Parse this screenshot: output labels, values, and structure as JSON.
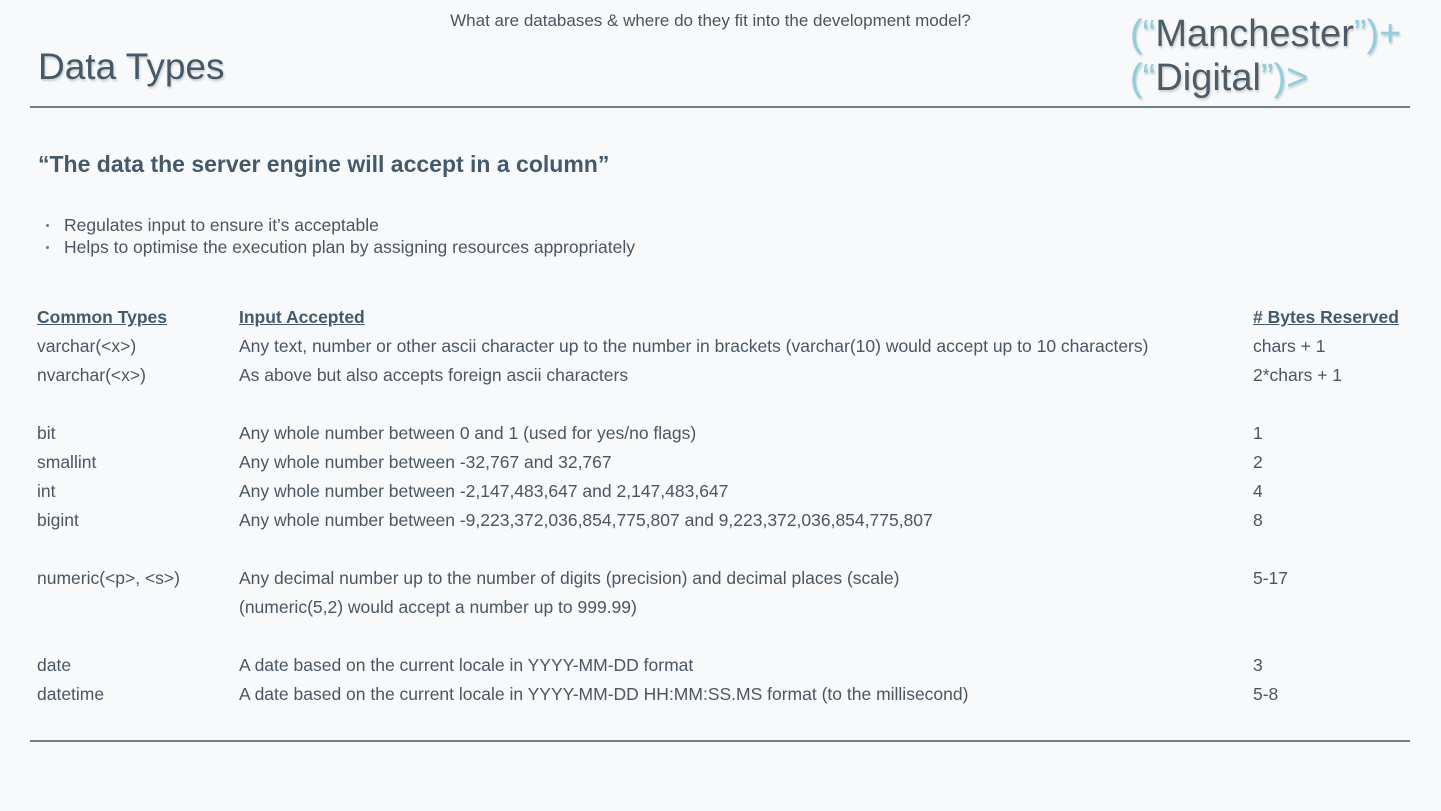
{
  "header": {
    "question": "What are databases & where do they fit into the development model?",
    "title": "Data Types",
    "logo": {
      "line1_open": "(“",
      "line1_word": "Manchester",
      "line1_close": "”)+",
      "line2_open": "(“",
      "line2_word": "Digital",
      "line2_close": "”)>"
    }
  },
  "quote": "“The data the server engine will accept in a column”",
  "bullets": [
    "Regulates input to ensure it’s acceptable",
    "Helps to optimise the execution plan by assigning resources appropriately"
  ],
  "table": {
    "headers": {
      "type": "Common Types",
      "input": "Input Accepted",
      "bytes": "# Bytes Reserved"
    },
    "rows": [
      {
        "type": "varchar(<x>)",
        "input": "Any text, number or other ascii character up to the number in brackets (varchar(10) would accept up to 10 characters)",
        "bytes": "chars + 1"
      },
      {
        "type": "nvarchar(<x>)",
        "input": "As above but also accepts foreign ascii characters",
        "bytes": "2*chars + 1"
      },
      {
        "type": "bit",
        "input": "Any whole number between 0 and 1 (used for yes/no flags)",
        "bytes": "1"
      },
      {
        "type": "smallint",
        "input": "Any whole number between -32,767 and 32,767",
        "bytes": "2"
      },
      {
        "type": "int",
        "input": "Any whole number between -2,147,483,647 and 2,147,483,647",
        "bytes": "4"
      },
      {
        "type": "bigint",
        "input": "Any whole number between -9,223,372,036,854,775,807 and 9,223,372,036,854,775,807",
        "bytes": "8"
      },
      {
        "type": "numeric(<p>, <s>)",
        "input": "Any decimal number up to the number of digits (precision) and decimal places (scale)",
        "bytes": "5-17"
      },
      {
        "type": "",
        "input": "(numeric(5,2) would accept a number up to 999.99)",
        "bytes": ""
      },
      {
        "type": "date",
        "input": "A date based on the current locale in YYYY-MM-DD format",
        "bytes": "3"
      },
      {
        "type": "datetime",
        "input": "A date based on the current locale in YYYY-MM-DD HH:MM:SS.MS format (to the millisecond)",
        "bytes": "5-8"
      }
    ]
  },
  "colors": {
    "background": "#f7f9fb",
    "title": "#44586a",
    "logo_accent": "#8fd0dc",
    "rule": "#6b7f8c"
  }
}
